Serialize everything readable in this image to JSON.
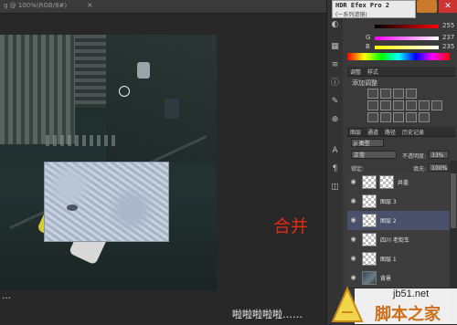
{
  "document": {
    "tab_title": "g @ 100%(RGB/8#)",
    "tab_close": "×"
  },
  "annotation": {
    "text": "合并",
    "color": "#e02a12"
  },
  "caption": {
    "text": "啦啦啦啦啦……",
    "left_ellipsis": "…"
  },
  "plugin_window": {
    "title": "HDR Efex Pro 2",
    "subtitle": "(一系列滤镜)"
  },
  "color_panel": {
    "sliders": [
      {
        "label": "",
        "value": "255",
        "gradient": "linear-gradient(90deg,#000,#f00)"
      },
      {
        "label": "G",
        "value": "237",
        "gradient": "linear-gradient(90deg,#f00,#ff0)"
      },
      {
        "label": "B",
        "value": "235",
        "gradient": "linear-gradient(90deg,#ff0000,#ff00ff)"
      }
    ]
  },
  "adjustments": {
    "tabs": [
      "调整",
      "样式"
    ],
    "title": "添加调整"
  },
  "layers_panel": {
    "tabs": [
      "图层",
      "通道",
      "路径",
      "历史记录"
    ],
    "filter_kind": "ρ 类型",
    "blend_mode": "正常",
    "opacity_label": "不透明度:",
    "opacity_value": "33%",
    "lock_label": "锁定:",
    "fill_label": "填充:",
    "fill_value": "100%",
    "layers": [
      {
        "name": "井盖",
        "thumb": "checker",
        "mask": true,
        "selected": false
      },
      {
        "name": "图层 3",
        "thumb": "checker",
        "mask": false,
        "selected": false
      },
      {
        "name": "图层 2",
        "thumb": "checker",
        "mask": false,
        "selected": true
      },
      {
        "name": "四川 老街车",
        "thumb": "checker",
        "mask": false,
        "selected": false
      },
      {
        "name": "图层 1",
        "thumb": "checker",
        "mask": false,
        "selected": false
      },
      {
        "name": "背景",
        "thumb": "photo",
        "mask": false,
        "selected": false
      }
    ]
  },
  "watermark": {
    "url": "jb51.net",
    "name": "脚本之家"
  }
}
